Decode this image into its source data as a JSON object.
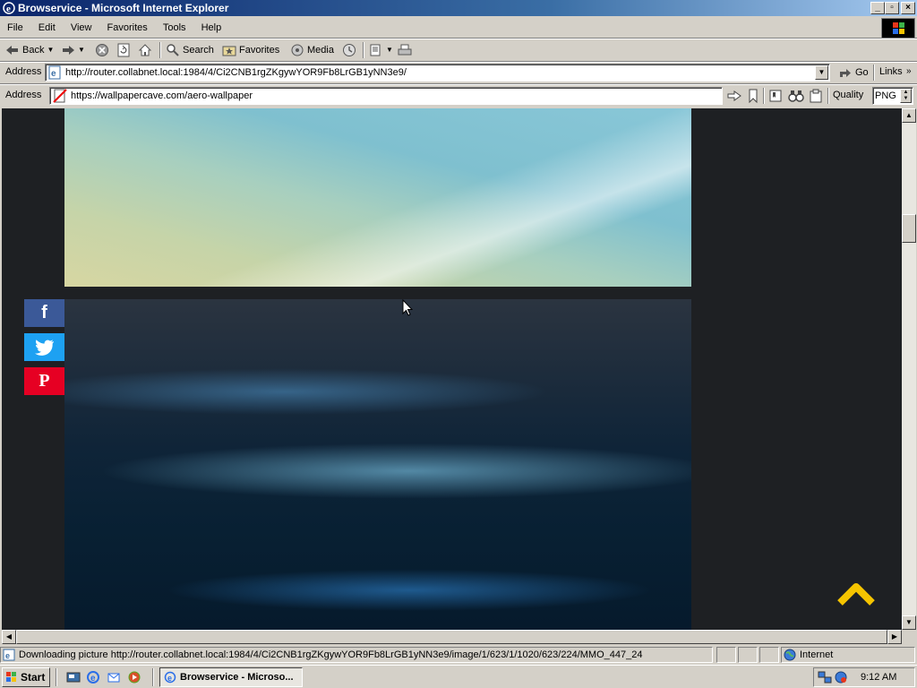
{
  "window": {
    "title": "Browservice - Microsoft Internet Explorer"
  },
  "menu": [
    "File",
    "Edit",
    "View",
    "Favorites",
    "Tools",
    "Help"
  ],
  "toolbar": {
    "back": "Back",
    "search": "Search",
    "favorites": "Favorites",
    "media": "Media"
  },
  "ie_address": {
    "label": "Address",
    "value": "http://router.collabnet.local:1984/4/Ci2CNB1rgZKgywYOR9Fb8LrGB1yNN3e9/",
    "go": "Go",
    "links": "Links"
  },
  "bs_address": {
    "label": "Address",
    "value": "https://wallpapercave.com/aero-wallpaper",
    "quality_label": "Quality",
    "quality_value": "PNG"
  },
  "social": {
    "facebook": "f",
    "pinterest": "P"
  },
  "status": {
    "text": "Downloading picture http://router.collabnet.local:1984/4/Ci2CNB1rgZKgywYOR9Fb8LrGB1yNN3e9/image/1/623/1/1020/623/224/MMO_447_24",
    "zone": "Internet"
  },
  "taskbar": {
    "start": "Start",
    "task": "Browservice - Microso...",
    "clock": "9:12 AM"
  },
  "colors": {
    "facebook": "#3b5998",
    "twitter": "#1da1f2",
    "pinterest": "#e60023",
    "scroll_top_arrow": "#f5c400",
    "page_bg": "#1e2023"
  }
}
